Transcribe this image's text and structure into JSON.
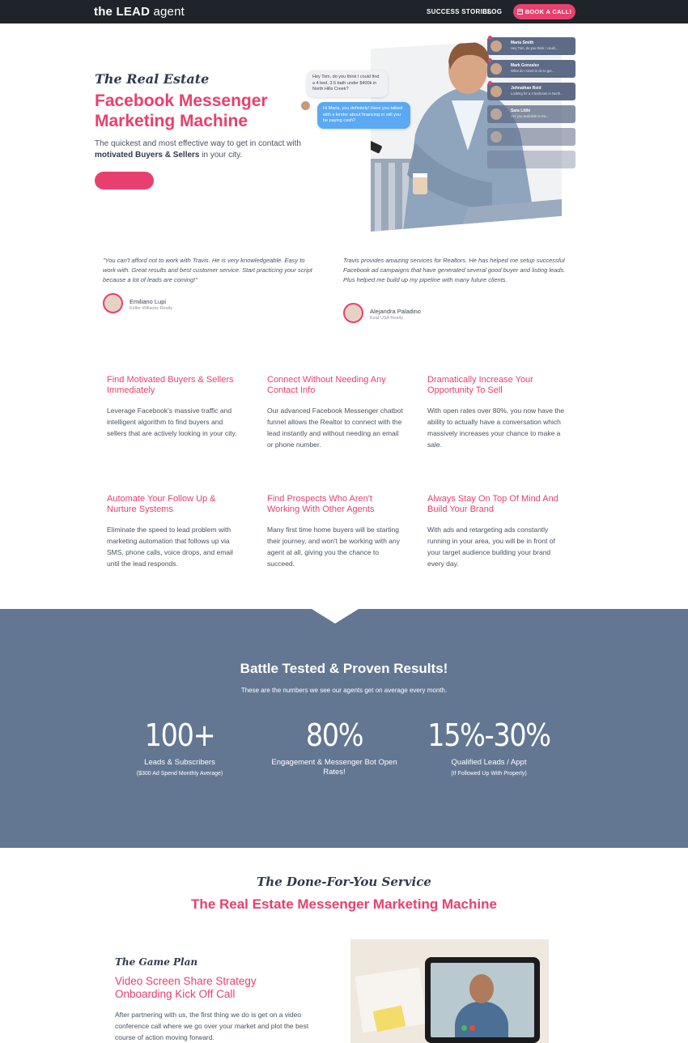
{
  "nav": {
    "logo_prefix": "the LEAD",
    "logo_suffix": " agent",
    "links": [
      "SUCCESS STORIES",
      "BLOG"
    ],
    "cta": "BOOK A CALL!"
  },
  "hero": {
    "kicker": "The Real Estate",
    "title": "Facebook Messenger Marketing Machine",
    "sub_pre": "The quickest and most effective way to get in contact with ",
    "sub_bold": "motivated Buyers & Sellers",
    "sub_post": " in your city.",
    "bubble_1": "Hey Tom, do you think I could find a 4 bed, 3.5 bath under $400k in North Hills Creek?",
    "bubble_2": "Hi Maria, you definitely! Have you talked with a lender about financing or will you be paying cash?",
    "messages": [
      {
        "name": "Maria Smith",
        "text": "Hey Tom, do you think I could..."
      },
      {
        "name": "Mark Gonzalez",
        "text": "What do I need to do to get..."
      },
      {
        "name": "Johnathan Reid",
        "text": "Looking for a 3 bedroom in North..."
      },
      {
        "name": "Sara Little",
        "text": "Are you available to me..."
      },
      {
        "name": "",
        "text": ""
      },
      {
        "name": "",
        "text": ""
      }
    ]
  },
  "testimonials": [
    {
      "quote": "\"You can't afford not to work with Travis. He is very knowledgeable. Easy to work with. Great results and best customer service. Start practicing your script because a lot of leads are coming!\"",
      "name": "Emiliano Lupi",
      "company": "Keller Williams Realty"
    },
    {
      "quote": "Travis provides amazing services for Realtors. He has helped me setup successful Facebook ad campaigns that have generated several good buyer and listing leads. Plus helped me build up my pipeline with many future clients.",
      "name": "Alejandra Paladino",
      "company": "Keat USA Realty"
    }
  ],
  "features": [
    {
      "title": "Find Motivated Buyers & Sellers Immediately",
      "body": "Leverage Facebook's massive traffic and intelligent algorithm to find buyers and sellers that are actively looking in your city."
    },
    {
      "title": "Connect Without Needing Any Contact Info",
      "body": "Our advanced Facebook Messenger chatbot funnel allows the Realtor to connect with the lead instantly and without needing an email or phone number."
    },
    {
      "title": "Dramatically Increase Your Opportunity To Sell",
      "body": "With open rates over 80%, you now have the ability to actually have a conversation which massively increases your chance to make a sale."
    },
    {
      "title": "Automate Your Follow Up & Nurture Systems",
      "body": "Eliminate the speed to lead problem with marketing automation that follows up via SMS, phone calls, voice drops, and email until the lead responds."
    },
    {
      "title": "Find Prospects Who Aren't Working With Other Agents",
      "body": "Many first time home buyers will be starting their journey, and won't be working with any agent at all, giving you the chance to succeed."
    },
    {
      "title": "Always Stay On Top Of Mind And Build Your Brand",
      "body": "With ads and retargeting ads constantly running in your area, you will be in front of your target audience building your brand every day."
    }
  ],
  "results": {
    "title": "Battle Tested & Proven Results!",
    "subtitle": "These are the numbers we see our agents get on average every month.",
    "stats": [
      {
        "value": "100+",
        "label": "Leads & Subscribers",
        "note": "($300 Ad Spend Monthly Average)"
      },
      {
        "value": "80%",
        "label": "Engagement & Messenger Bot Open Rates!",
        "note": ""
      },
      {
        "value": "15%-30%",
        "label": "Qualified Leads / Appt",
        "note": "(If Followed Up With Properly)"
      }
    ]
  },
  "service": {
    "kicker": "The Done-For-You Service",
    "title": "The Real Estate Messenger Marketing Machine",
    "plan_kicker": "The Game Plan",
    "plan_title": "Video Screen Share Strategy Onboarding Kick Off Call",
    "plan_body": "After partnering with us, the first thing we do is get on a video conference call where we go over your market and plot the best course of action moving forward."
  },
  "colors": {
    "accent": "#e8406e",
    "nav_bg": "#1e2429",
    "band_bg": "#637792",
    "heading": "#2f3a4f"
  }
}
